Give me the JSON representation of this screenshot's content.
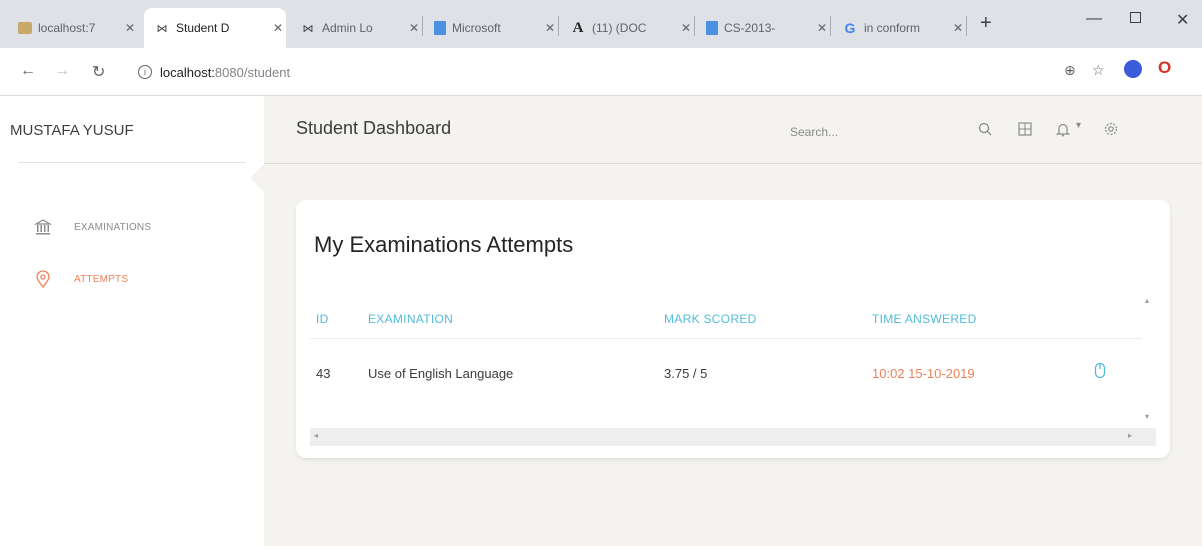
{
  "browser": {
    "tabs": [
      {
        "label": "localhost:7",
        "icon": "image-favicon"
      },
      {
        "label": "Student D",
        "icon": "bowtie-favicon",
        "active": true
      },
      {
        "label": "Admin Lo",
        "icon": "bowtie-favicon"
      },
      {
        "label": "Microsoft",
        "icon": "doc-favicon"
      },
      {
        "label": "(11) (DOC",
        "icon": "a-favicon"
      },
      {
        "label": "CS-2013-",
        "icon": "doc-favicon"
      },
      {
        "label": "in conform",
        "icon": "google-favicon"
      }
    ],
    "url_host": "localhost:",
    "url_path": "8080/student"
  },
  "sidebar": {
    "user_name": "MUSTAFA YUSUF",
    "items": [
      {
        "label": "EXAMINATIONS",
        "icon": "bank-icon"
      },
      {
        "label": "ATTEMPTS",
        "icon": "map-pin-icon",
        "active": true
      }
    ]
  },
  "topnav": {
    "title": "Student Dashboard",
    "search_placeholder": "Search..."
  },
  "card": {
    "title": "My Examinations Attempts",
    "columns": [
      "ID",
      "EXAMINATION",
      "MARK SCORED",
      "TIME ANSWERED"
    ],
    "rows": [
      {
        "id": "43",
        "examination": "Use of English Language",
        "mark": "3.75 / 5",
        "time": "10:02 15-10-2019",
        "action_icon": "mouse-icon"
      }
    ]
  },
  "colors": {
    "accent_teal": "#51bcda",
    "accent_orange": "#ef8157",
    "background": "#f4f3ef"
  }
}
